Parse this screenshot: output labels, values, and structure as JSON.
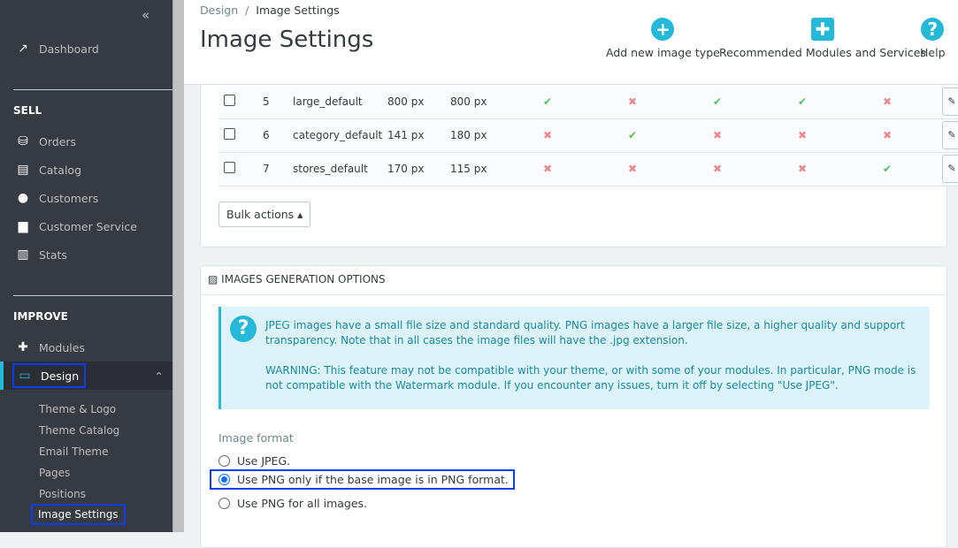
{
  "sidebar": {
    "collapse": "«",
    "dashboard": "Dashboard",
    "sell": "SELL",
    "sell_items": [
      "Orders",
      "Catalog",
      "Customers",
      "Customer Service",
      "Stats"
    ],
    "improve": "IMPROVE",
    "modules": "Modules",
    "design": "Design",
    "design_sub": [
      "Theme & Logo",
      "Theme Catalog",
      "Email Theme",
      "Pages",
      "Positions",
      "Image Settings"
    ]
  },
  "header": {
    "breadcrumb": [
      "Design",
      "Image Settings"
    ],
    "title": "Image Settings",
    "toolbar": [
      "Add new image type",
      "Recommended Modules and Services",
      "Help"
    ]
  },
  "table": {
    "rows": [
      {
        "id": "5",
        "name": "large_default",
        "w": "800 px",
        "h": "800 px",
        "flags": [
          true,
          false,
          true,
          true,
          false
        ]
      },
      {
        "id": "6",
        "name": "category_default",
        "w": "141 px",
        "h": "180 px",
        "flags": [
          false,
          true,
          false,
          false,
          false
        ]
      },
      {
        "id": "7",
        "name": "stores_default",
        "w": "170 px",
        "h": "115 px",
        "flags": [
          false,
          false,
          false,
          false,
          true
        ]
      }
    ],
    "bulk": "Bulk actions ▴"
  },
  "gen": {
    "title": "IMAGES GENERATION OPTIONS",
    "info1": "JPEG images have a small file size and standard quality. PNG images have a larger file size, a higher quality and support transparency. Note that in all cases the image files will have the .jpg extension.",
    "info2": "WARNING: This feature may not be compatible with your theme, or with some of your modules. In particular, PNG mode is not compatible with the Watermark module. If you encounter any issues, turn it off by selecting \"Use JPEG\".",
    "format_label": "Image format",
    "options": [
      "Use JPEG.",
      "Use PNG only if the base image is in PNG format.",
      "Use PNG for all images."
    ],
    "selected": 1
  },
  "colors": {
    "accent": "#25b9d7",
    "sidebar": "#363a41",
    "check": "#5cb85c",
    "cross": "#e48b8f",
    "highlight": "#0b3cf5"
  }
}
